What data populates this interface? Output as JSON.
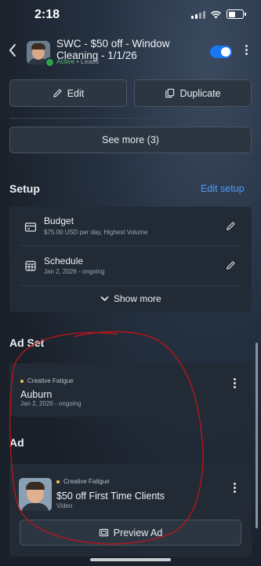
{
  "status_bar": {
    "time": "2:18"
  },
  "header": {
    "title": "SWC - $50 off - Window Cleaning - 1/1/26",
    "status_active": "Active",
    "status_sep": " • ",
    "status_type": "Leads",
    "toggle_on": true
  },
  "actions": {
    "edit_label": "Edit",
    "duplicate_label": "Duplicate",
    "see_more_label": "See more (3)"
  },
  "setup": {
    "title": "Setup",
    "edit_link": "Edit setup",
    "budget": {
      "label": "Budget",
      "detail": "$75.00 USD per day, Highest Volume"
    },
    "schedule": {
      "label": "Schedule",
      "detail": "Jan 2, 2026 - ongoing"
    },
    "show_more_label": "Show more"
  },
  "ad_set": {
    "title": "Ad Set",
    "badge": "Creative Fatigue",
    "name": "Auburn",
    "dates": "Jan 2, 2026 - ongoing"
  },
  "ad": {
    "title": "Ad",
    "badge": "Creative Fatigue",
    "name": "$50 off First Time Clients",
    "format": "Video",
    "preview_label": "Preview Ad"
  },
  "colors": {
    "accent": "#1877f2",
    "link": "#4f9bff",
    "active": "#31a24c",
    "badge_dot": "#f2c94c",
    "annotation": "#b5161c"
  },
  "icons": [
    "back-icon",
    "pencil-icon",
    "duplicate-icon",
    "card-icon",
    "calendar-icon",
    "chevron-down-icon",
    "more-icon",
    "preview-icon"
  ]
}
